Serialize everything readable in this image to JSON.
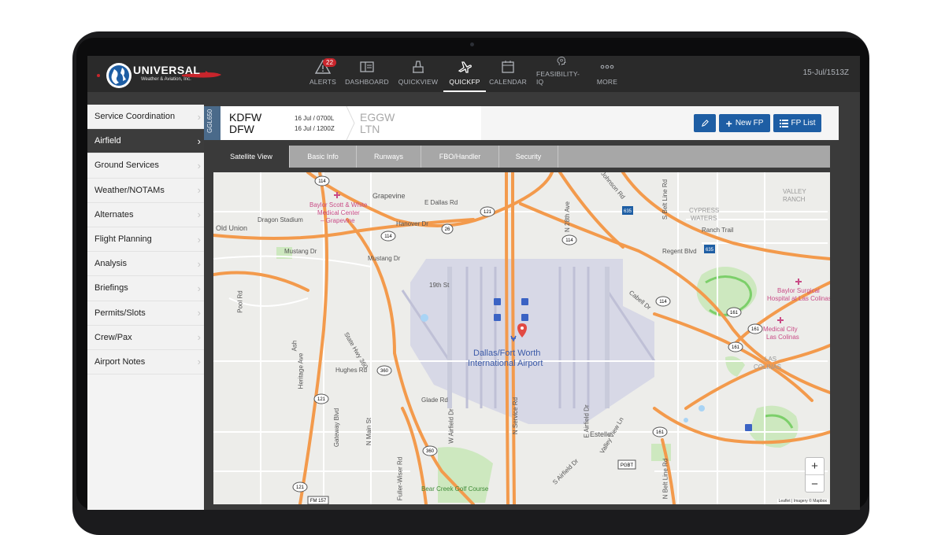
{
  "nav": {
    "items": [
      {
        "label": "ALERTS",
        "icon": "warning-icon",
        "badge": "22"
      },
      {
        "label": "DASHBOARD",
        "icon": "dashboard-icon"
      },
      {
        "label": "QUICKVIEW",
        "icon": "quickview-icon"
      },
      {
        "label": "QUICKFP",
        "icon": "airplane-icon"
      },
      {
        "label": "CALENDAR",
        "icon": "calendar-icon"
      },
      {
        "label": "FEASIBILITY-IQ",
        "icon": "brain-icon"
      },
      {
        "label": "MORE",
        "icon": "more-icon"
      }
    ],
    "active": "QUICKFP",
    "clock": "15-Jul/1513Z"
  },
  "logo": {
    "name": "UNIVERSAL",
    "sub": "Weather & Aviation, Inc."
  },
  "sidebar": {
    "items": [
      {
        "label": "Service Coordination"
      },
      {
        "label": "Airfield"
      },
      {
        "label": "Ground Services"
      },
      {
        "label": "Weather/NOTAMs"
      },
      {
        "label": "Alternates"
      },
      {
        "label": "Flight Planning"
      },
      {
        "label": "Analysis"
      },
      {
        "label": "Briefings"
      },
      {
        "label": "Permits/Slots"
      },
      {
        "label": "Crew/Pax"
      },
      {
        "label": "Airport Notes"
      }
    ],
    "active": "Airfield"
  },
  "flight": {
    "tail": "GGL650",
    "dep_icao": "KDFW",
    "dep_iata": "DFW",
    "dep_local": "16 Jul / 0700L",
    "dep_utc": "16 Jul / 1200Z",
    "arr_icao": "EGGW",
    "arr_iata": "LTN"
  },
  "buttons": {
    "edit_icon": "pencil-icon",
    "new_fp": "New FP",
    "fp_list": "FP List"
  },
  "tabs": [
    "Satellite View",
    "Basic Info",
    "Runways",
    "FBO/Handler",
    "Security"
  ],
  "active_tab": "Satellite View",
  "map": {
    "labels": {
      "grapevine": "Grapevine",
      "baylor_grapevine_1": "Baylor Scott & White",
      "baylor_grapevine_2": "Medical Center",
      "baylor_grapevine_3": "– Grapevine",
      "dragon": "Dragon Stadium",
      "old_union": "Old Union",
      "mustang1": "Mustang Dr",
      "mustang2": "Mustang Dr",
      "hanover": "Hanover Dr",
      "e_dallas": "E Dallas Rd",
      "johnson": "Johnson Rd",
      "n_28th": "N 28th Ave",
      "s_belt": "S Belt Line Rd",
      "valley_ranch_1": "VALLEY",
      "valley_ranch_2": "RANCH",
      "cypress_1": "CYPRESS",
      "cypress_2": "WATERS",
      "ranch_trail": "Ranch Trail",
      "regent": "Regent Blvd",
      "st19": "19th St",
      "pool": "Pool Rd",
      "baylor_surgical_1": "Baylor Surgical",
      "baylor_surgical_2": "Hospital at Las Colinas",
      "cabell": "Cabell Dr",
      "medical_city_1": "Medical City",
      "medical_city_2": "Las Colinas",
      "las_colinas_1": "LAS",
      "las_colinas_2": "COLINAS",
      "airport_1": "Dallas/Fort Worth",
      "airport_2": "International Airport",
      "state_hwy": "State Hwy 360",
      "hughes": "Hughes Rd",
      "heritage": "Heritage Ave",
      "glade": "Glade Rd",
      "w_airfield": "W Airfield Dr",
      "n_service": "N Service Rd",
      "e_airfield": "E Airfield Dr",
      "valley_view": "Valley View Ln",
      "gateway": "Gateway Blvd",
      "n_main": "N Main St",
      "fuller": "Fuller-Wiser Rd",
      "s_airfield": "S Airfield Dr",
      "estelle": "Estelle",
      "n_belt": "N Belt Line Rd",
      "bear_creek": "Bear Creek Golf Course",
      "ash": "Ash",
      "shields": [
        "114",
        "121",
        "26",
        "114",
        "114",
        "360",
        "121",
        "360",
        "114",
        "161",
        "161",
        "161",
        "635",
        "635",
        "PGBT",
        "FM 157",
        "121",
        "161"
      ]
    },
    "zoom_in": "+",
    "zoom_out": "−",
    "attribution": "Leaflet | Imagery © Mapbox"
  },
  "colors": {
    "accent": "#1e5ea4",
    "road": "#f39a4c",
    "runway": "#c9cbdb",
    "water": "#a9d4f5",
    "park": "#b9dfa3"
  }
}
